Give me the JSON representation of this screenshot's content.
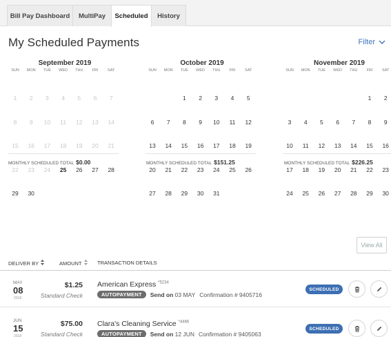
{
  "tabs": [
    {
      "label": "Bill Pay Dashboard",
      "active": false
    },
    {
      "label": "MultiPay",
      "active": false
    },
    {
      "label": "Scheduled",
      "active": true
    },
    {
      "label": "History",
      "active": false
    }
  ],
  "page_title": "My Scheduled Payments",
  "filter_label": "Filter",
  "dow": [
    "SUN",
    "MON",
    "TUE",
    "WED",
    "THU",
    "FRI",
    "SAT"
  ],
  "calendars": [
    {
      "title": "September 2019",
      "first_weekday": 0,
      "days_in_month": 30,
      "active_from": 25,
      "bold_day": 25,
      "total_label": "MONTHLY SCHEDULED TOTAL",
      "total": "$0.00"
    },
    {
      "title": "October 2019",
      "first_weekday": 2,
      "days_in_month": 31,
      "active_from": 1,
      "bold_day": null,
      "total_label": "MONTHLY SCHEDULED TOTAL",
      "total": "$151.25"
    },
    {
      "title": "November 2019",
      "first_weekday": 5,
      "days_in_month": 30,
      "active_from": 1,
      "bold_day": null,
      "total_label": "MONTHLY SCHEDULED TOTAL",
      "total": "$226.25"
    }
  ],
  "view_all_label": "View All",
  "table_headers": {
    "deliver_by": "DELIVER BY",
    "amount": "AMOUNT",
    "details": "TRANSACTION DETAILS"
  },
  "payments": [
    {
      "month": "MAY",
      "day": "08",
      "year": "2018",
      "amount": "$1.25",
      "method": "Standard Check",
      "payee": "American Express",
      "account": "*5234",
      "tag": "AUTOPAYMENT",
      "send_label": "Send on",
      "send_date": "03 MAY",
      "confirmation": "Confirmation # 9405716",
      "status": "SCHEDULED"
    },
    {
      "month": "JUN",
      "day": "15",
      "year": "2018",
      "amount": "$75.00",
      "method": "Standard Check",
      "payee": "Clara's Cleaning Service",
      "account": "*4466",
      "tag": "AUTOPAYMENT",
      "send_label": "Send on",
      "send_date": "12 JUN",
      "confirmation": "Confirmation # 9405063",
      "status": "SCHEDULED"
    }
  ],
  "colors": {
    "accent": "#3d74b8",
    "status_badge": "#3d6fb3",
    "autopay_tag": "#6d6d6d"
  },
  "icons": {
    "filter": "chevron-down-icon",
    "sort": "sort-arrows-icon",
    "delete": "trash-icon",
    "edit": "pencil-icon"
  }
}
